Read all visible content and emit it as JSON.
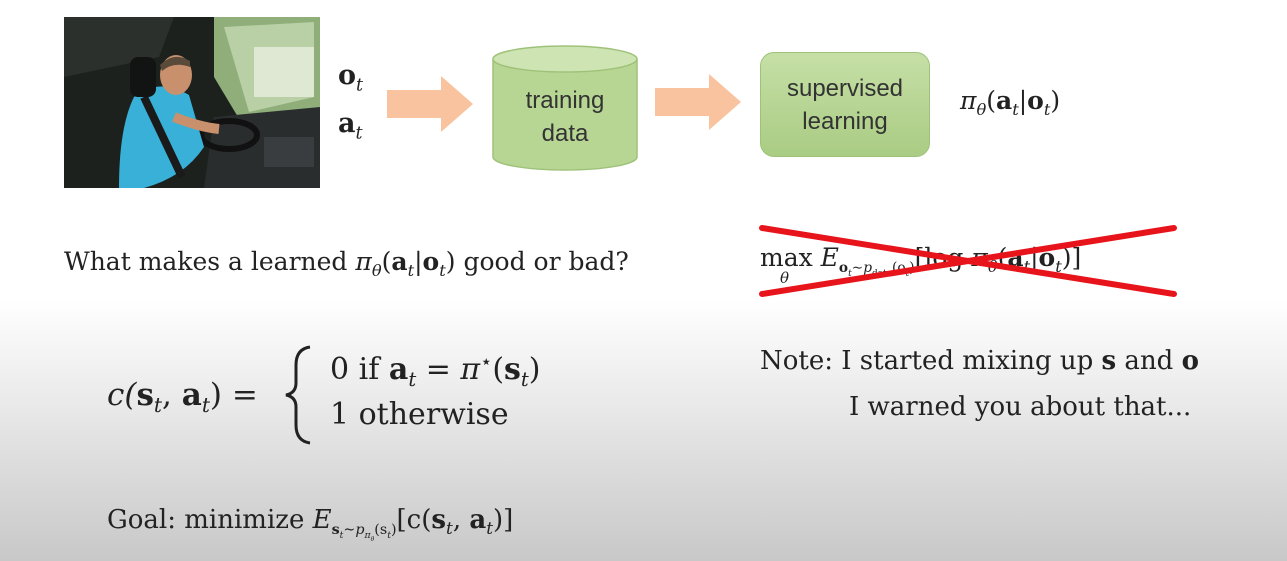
{
  "pipeline": {
    "obs_label": "o",
    "obs_sub": "t",
    "act_label": "a",
    "act_sub": "t",
    "training_line1": "training",
    "training_line2": "data",
    "supervised_line1": "supervised",
    "supervised_line2": "learning",
    "policy": {
      "pi": "π",
      "theta": "θ",
      "open": "(",
      "a": "a",
      "t1": "t",
      "bar": "|",
      "o": "o",
      "t2": "t",
      "close": ")"
    }
  },
  "question": {
    "prefix": "What makes a learned ",
    "suffix": " good or bad?"
  },
  "crossed": {
    "max": "max",
    "theta": "θ",
    "E": "E",
    "sub_o": "o",
    "sub_t": "t",
    "sub_sim": "∼",
    "sub_p": "p",
    "sub_data": "data",
    "sub_arg": "(o",
    "sub_arg_t": "t",
    "sub_close": ")",
    "bracket_open": "[",
    "log": "log",
    "bracket_close": "]"
  },
  "cost": {
    "lhs": "c(",
    "s": "s",
    "t1": "t",
    "comma": ", ",
    "a": "a",
    "t2": "t",
    "rhs": ") =",
    "case1_prefix": "0 if ",
    "case1_a": "a",
    "case1_t": "t",
    "case1_eq": " = ",
    "case1_pi": "π",
    "case1_star": "⋆",
    "case1_arg": "(",
    "case1_s": "s",
    "case1_st": "t",
    "case1_close": ")",
    "case2": "1 otherwise"
  },
  "note": {
    "line1_prefix": "Note: I started mixing up ",
    "line1_s": "s",
    "line1_and": " and ",
    "line1_o": "o",
    "line2": "I warned you about that..."
  },
  "goal": {
    "prefix": "Goal: minimize ",
    "E": "E",
    "sub_s": "s",
    "sub_t": "t",
    "sub_sim": "∼",
    "sub_p": "p",
    "sub_pi": "π",
    "sub_theta": "θ",
    "sub_arg": "(s",
    "sub_arg_t": "t",
    "sub_close": ")",
    "body_open": "[c(",
    "s": "s",
    "t1": "t",
    "comma": ", ",
    "a": "a",
    "t2": "t",
    "body_close": ")]"
  },
  "colors": {
    "arrow": "#f8c39e",
    "green_light": "#c6dfa6",
    "green_dark": "#a9cc83",
    "cross": "#e8141b"
  }
}
